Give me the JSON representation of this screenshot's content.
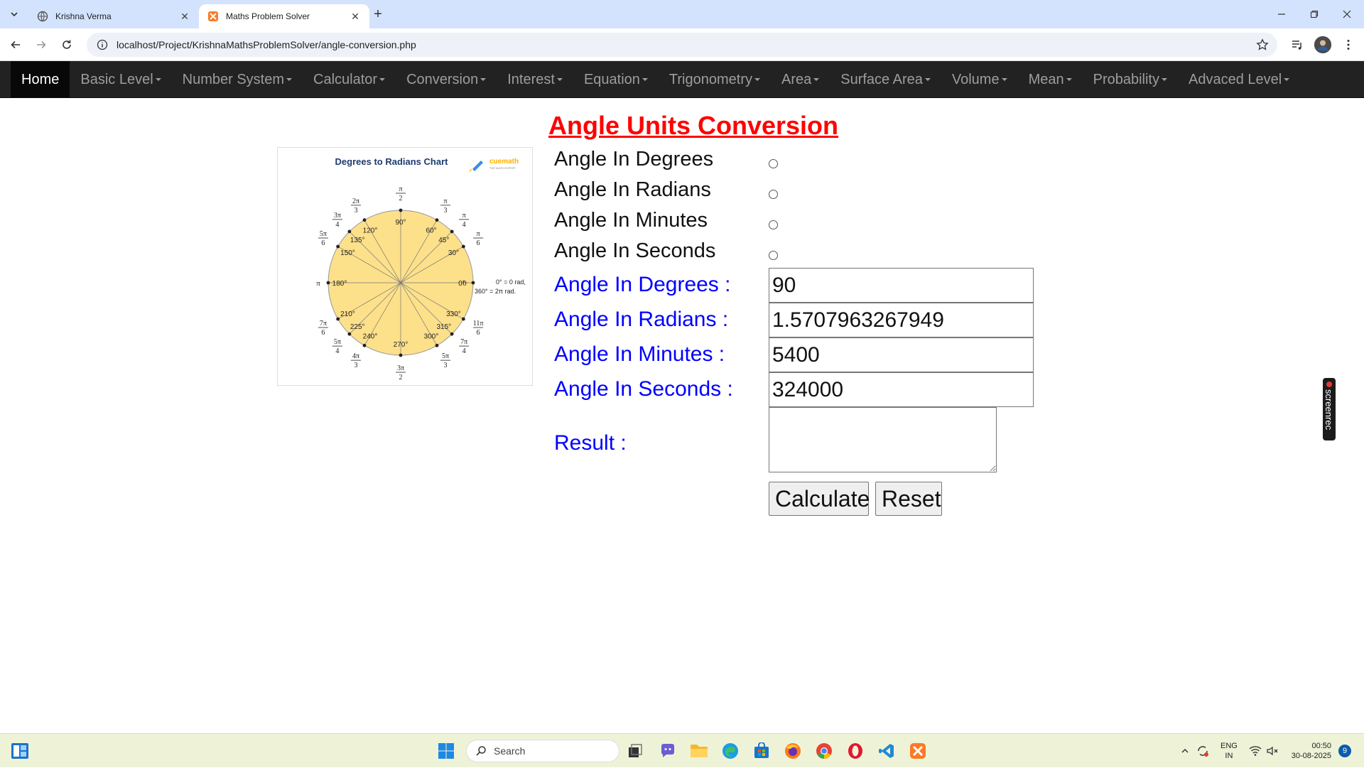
{
  "browser": {
    "tabs": [
      {
        "title": "Krishna Verma",
        "active": false
      },
      {
        "title": "Maths Problem Solver",
        "active": true
      }
    ],
    "url": "localhost/Project/KrishnaMathsProblemSolver/angle-conversion.php"
  },
  "nav": {
    "items": [
      {
        "label": "Home",
        "dropdown": false,
        "active": true
      },
      {
        "label": "Basic Level",
        "dropdown": true
      },
      {
        "label": "Number System",
        "dropdown": true
      },
      {
        "label": "Calculator",
        "dropdown": true
      },
      {
        "label": "Conversion",
        "dropdown": true
      },
      {
        "label": "Interest",
        "dropdown": true
      },
      {
        "label": "Equation",
        "dropdown": true
      },
      {
        "label": "Trigonometry",
        "dropdown": true
      },
      {
        "label": "Area",
        "dropdown": true
      },
      {
        "label": "Surface Area",
        "dropdown": true
      },
      {
        "label": "Volume",
        "dropdown": true
      },
      {
        "label": "Mean",
        "dropdown": true
      },
      {
        "label": "Probability",
        "dropdown": true
      },
      {
        "label": "Advaced Level",
        "dropdown": true
      }
    ]
  },
  "page": {
    "heading": "Angle Units Conversion",
    "options": [
      {
        "label": "Angle In Degrees",
        "checked": false
      },
      {
        "label": "Angle In Radians",
        "checked": false
      },
      {
        "label": "Angle In Minutes",
        "checked": false
      },
      {
        "label": "Angle In Seconds",
        "checked": false
      }
    ],
    "fields": [
      {
        "label": "Angle In Degrees :",
        "value": "90"
      },
      {
        "label": "Angle In Radians :",
        "value": "1.5707963267949"
      },
      {
        "label": "Angle In Minutes :",
        "value": "5400"
      },
      {
        "label": "Angle In Seconds :",
        "value": "324000"
      }
    ],
    "result_label": "Result :",
    "result_value": "",
    "calculate_label": "Calculate",
    "reset_label": "Reset"
  },
  "chart_image": {
    "title": "Degrees to Radians Chart",
    "brand": "cuemath",
    "brand_tagline": "THE MATH EXPERT",
    "zero_note_line1": "0° = 0 rad,",
    "zero_note_line2": "360° = 2π rad.",
    "pi_label": "π",
    "zero_label": "0",
    "angles": [
      {
        "deg": "0°",
        "rad_num": "",
        "rad_den": ""
      },
      {
        "deg": "30°",
        "rad_num": "π",
        "rad_den": "6"
      },
      {
        "deg": "45°",
        "rad_num": "π",
        "rad_den": "4"
      },
      {
        "deg": "60°",
        "rad_num": "π",
        "rad_den": "3"
      },
      {
        "deg": "90°",
        "rad_num": "π",
        "rad_den": "2"
      },
      {
        "deg": "120°",
        "rad_num": "2π",
        "rad_den": "3"
      },
      {
        "deg": "135°",
        "rad_num": "3π",
        "rad_den": "4"
      },
      {
        "deg": "150°",
        "rad_num": "5π",
        "rad_den": "6"
      },
      {
        "deg": "180°",
        "rad_num": "",
        "rad_den": ""
      },
      {
        "deg": "210°",
        "rad_num": "7π",
        "rad_den": "6"
      },
      {
        "deg": "225°",
        "rad_num": "5π",
        "rad_den": "4"
      },
      {
        "deg": "240°",
        "rad_num": "4π",
        "rad_den": "3"
      },
      {
        "deg": "270°",
        "rad_num": "3π",
        "rad_den": "2"
      },
      {
        "deg": "300°",
        "rad_num": "5π",
        "rad_den": "3"
      },
      {
        "deg": "315°",
        "rad_num": "7π",
        "rad_den": "4"
      },
      {
        "deg": "330°",
        "rad_num": "11π",
        "rad_den": "6"
      }
    ],
    "fill_color": "#fde08a"
  },
  "overlay": {
    "screenrec": "screenrec"
  },
  "taskbar": {
    "search_placeholder": "Search",
    "lang_line1": "ENG",
    "lang_line2": "IN",
    "time": "00:50",
    "date": "30-08-2025",
    "notifications": "9"
  },
  "colors": {
    "heading": "#ff0000",
    "field_label": "#0000ff",
    "nav_bg": "#222222",
    "nav_active_bg": "#080808"
  }
}
